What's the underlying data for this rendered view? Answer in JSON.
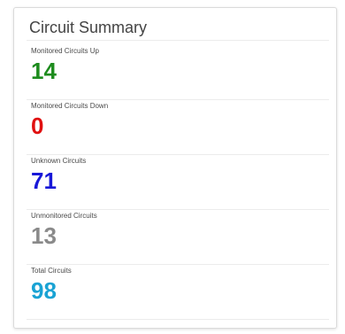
{
  "panel": {
    "title": "Circuit Summary"
  },
  "stats": [
    {
      "label": "Monitored Circuits Up",
      "value": "14",
      "color": "#1e8c1e"
    },
    {
      "label": "Monitored Circuits Down",
      "value": "0",
      "color": "#e01010"
    },
    {
      "label": "Unknown Circuits",
      "value": "71",
      "color": "#1818d8"
    },
    {
      "label": "Unmonitored Circuits",
      "value": "13",
      "color": "#8a8a8a"
    },
    {
      "label": "Total Circuits",
      "value": "98",
      "color": "#1aa3d4"
    }
  ]
}
